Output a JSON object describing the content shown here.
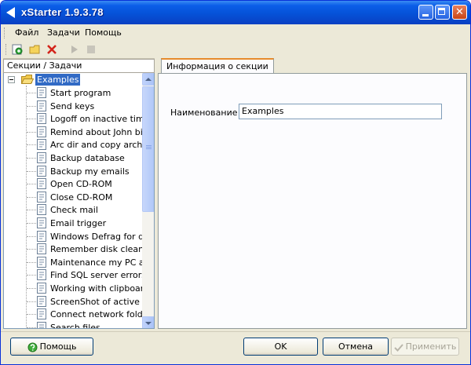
{
  "window": {
    "title": "xStarter 1.9.3.78"
  },
  "menubar": [
    "Файл",
    "Задачи",
    "Помощь"
  ],
  "left_pane": {
    "caption": "Секции / Задачи",
    "root": "Examples",
    "tasks": [
      "Start program",
      "Send keys",
      "Logoff on inactive time",
      "Remind about John bir...",
      "Arc dir and copy archive",
      "Backup database",
      "Backup my emails",
      "Open CD-ROM",
      "Close CD-ROM",
      "Check mail",
      "Email trigger",
      "Windows Defrag for di...",
      "Remember disk cleanu...",
      "Maintenance my PC an...",
      "Find SQL server errors",
      "Working with clipboard...",
      "ScreenShot of active ...",
      "Connect network folders",
      "Search files"
    ]
  },
  "right_pane": {
    "tab": "Информация о секции",
    "field_label": "Наименование",
    "field_value": "Examples"
  },
  "buttons": {
    "help": "Помощь",
    "ok": "OK",
    "cancel": "Отмена",
    "apply": "Применить"
  },
  "colors": {
    "titlebar": "#0552d8",
    "selection": "#316ac5",
    "tab_accent": "#e68b2c",
    "window_bg": "#ece9d8"
  }
}
